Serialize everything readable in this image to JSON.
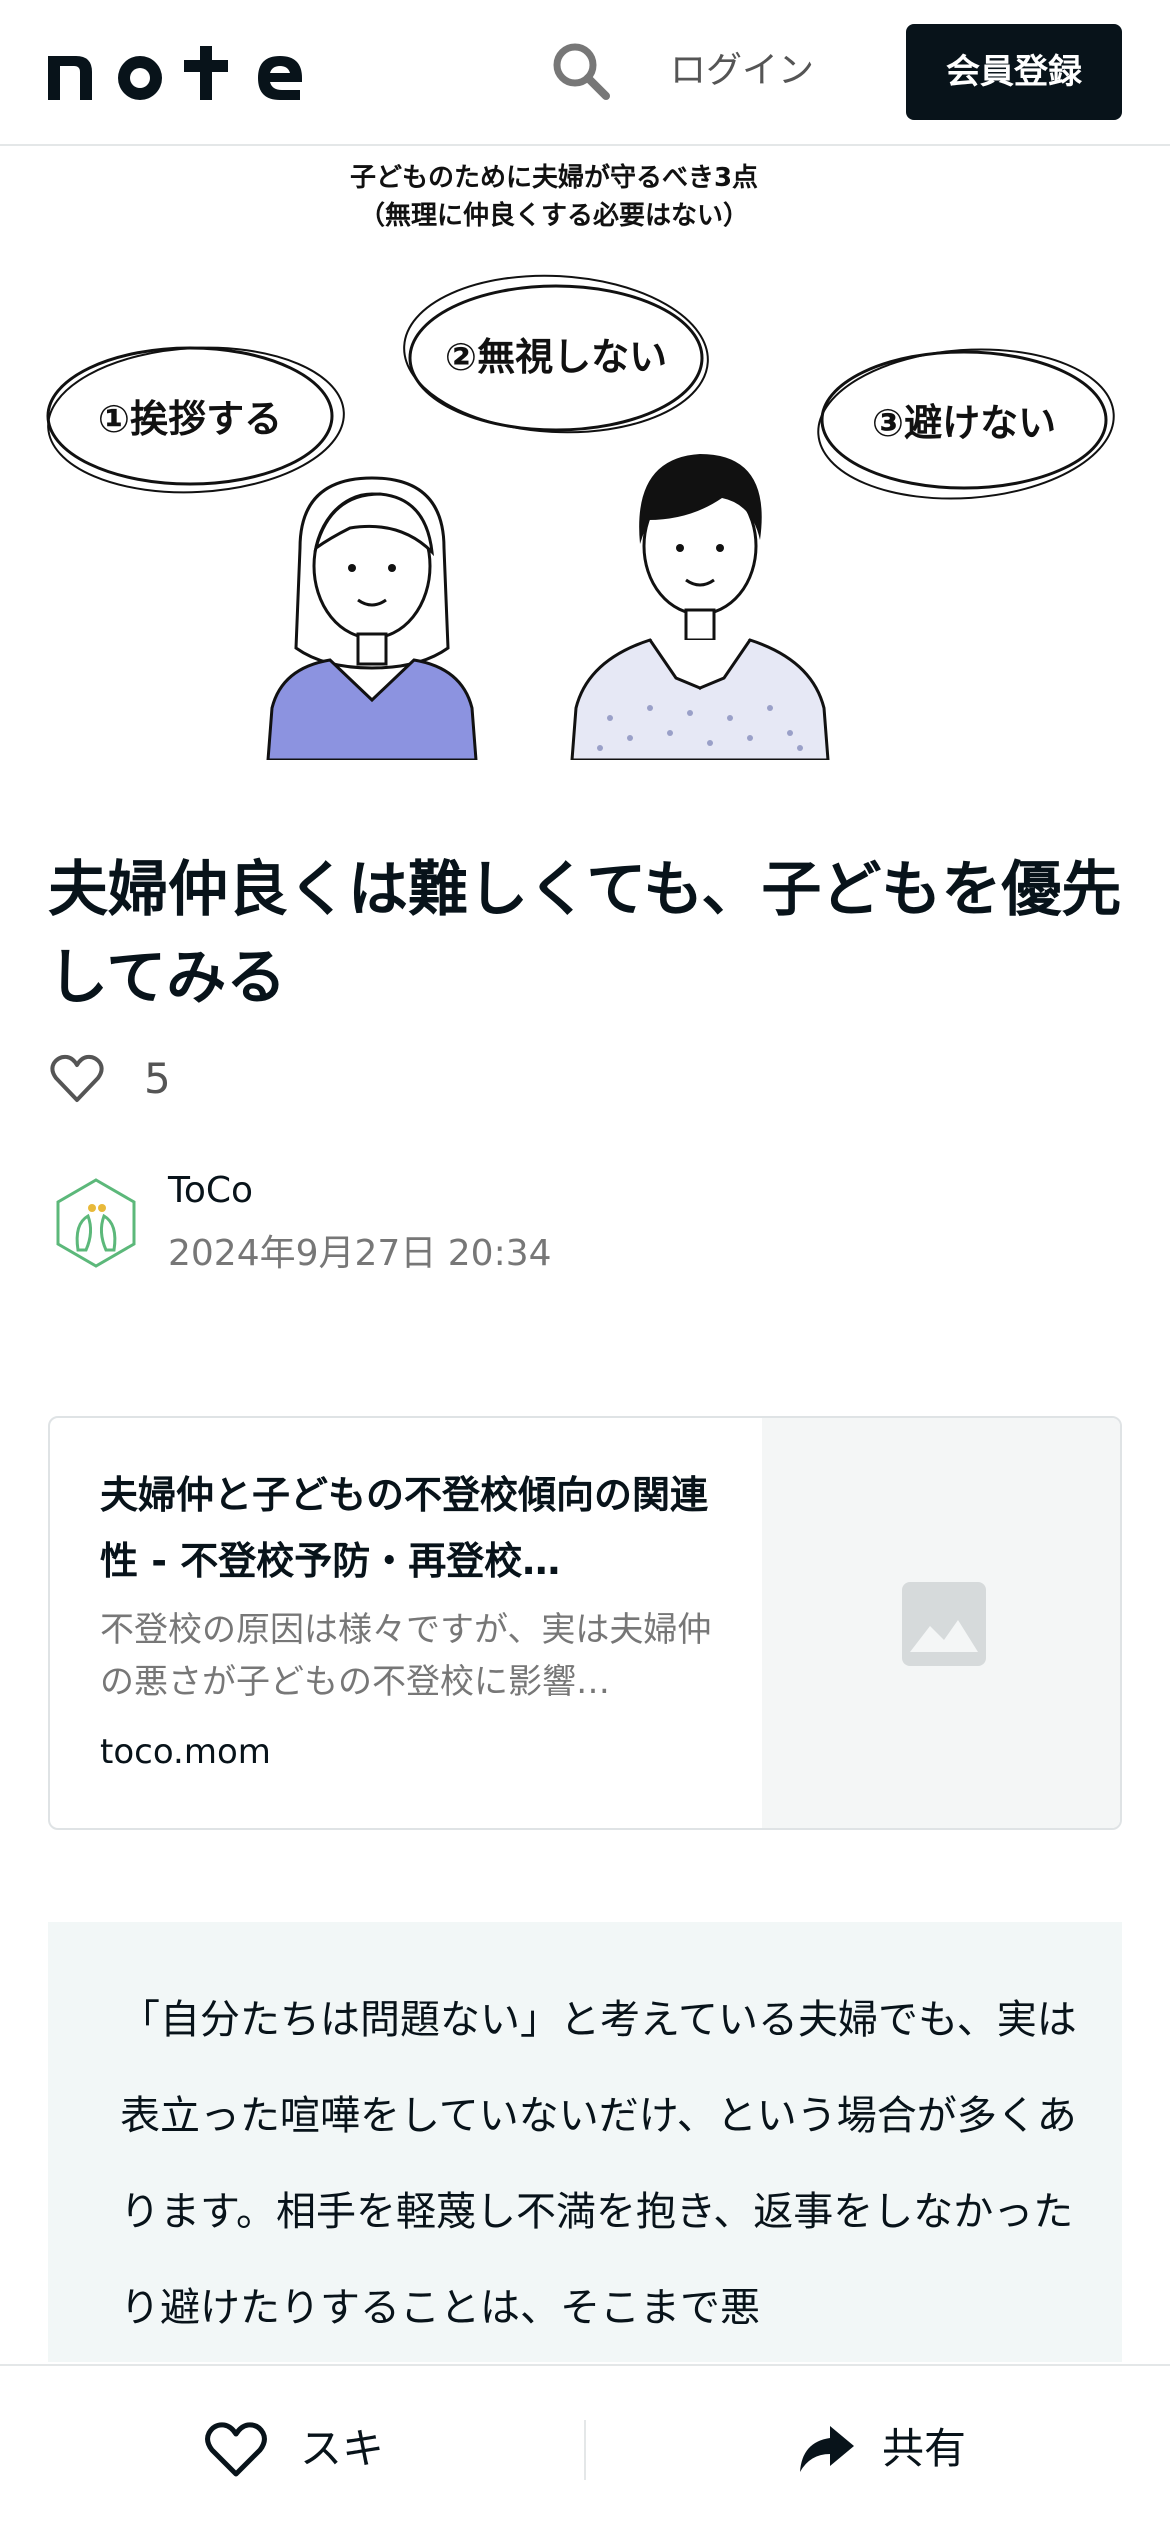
{
  "header": {
    "logo_text": "note",
    "login_label": "ログイン",
    "signup_label": "会員登録"
  },
  "hero": {
    "heading_line1": "子どものために夫婦が守るべき3点",
    "heading_line2": "（無理に仲良くする必要はない）",
    "bubble1": "①挨拶する",
    "bubble2": "②無視しない",
    "bubble3": "③避けない"
  },
  "article": {
    "title": "夫婦仲良くは難しくても、子どもを優先してみる",
    "like_count": "5",
    "author_name": "ToCo",
    "date": "2024年9月27日 20:34"
  },
  "link_card": {
    "title": "夫婦仲と子どもの不登校傾向の関連性 - 不登校予防・再登校…",
    "description": "不登校の原因は様々ですが、実は夫婦仲の悪さが子どもの不登校に影響…",
    "domain": "toco.mom"
  },
  "quote": {
    "text": "「自分たちは問題ない」と考えている夫婦でも、実は表立った喧嘩をしていないだけ、という場合が多くあります。相手を軽蔑し不満を抱き、返事をしなかったり避けたりすることは、そこまで悪"
  },
  "bottom_bar": {
    "like_label": "スキ",
    "share_label": "共有"
  },
  "colors": {
    "primary_text": "#08131a",
    "signup_bg": "#08131a",
    "quote_bg": "#f2f7f7",
    "woman_shirt": "#8c93e0",
    "avatar_green": "#5cb87a"
  }
}
